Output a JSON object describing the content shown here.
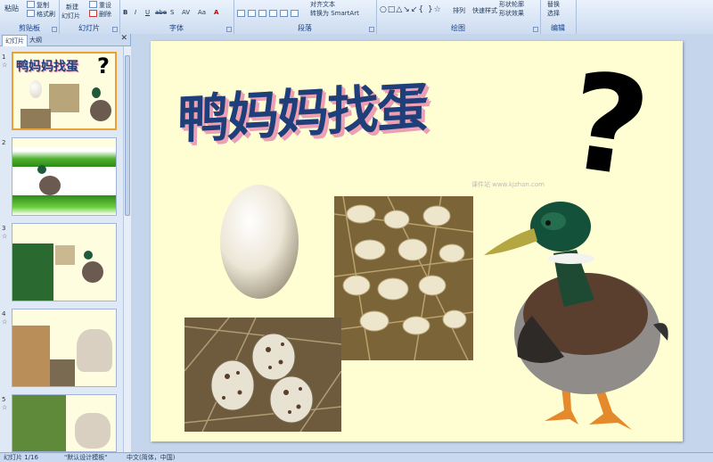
{
  "ribbon": {
    "clipboard": {
      "paste": "粘贴",
      "copy": "复制",
      "format_painter": "格式刷",
      "title": "剪贴板"
    },
    "slides": {
      "new_slide": "新建",
      "new_slide_2": "幻灯片",
      "reset": "重设",
      "delete": "删除",
      "title": "幻灯片"
    },
    "font": {
      "bold": "B",
      "italic": "I",
      "underline": "U",
      "strike": "abe",
      "shadow": "S",
      "spacing": "AV",
      "case": "Aa",
      "color": "A",
      "title": "字体"
    },
    "paragraph": {
      "text_direction": "对齐文本",
      "smartart": "转换为 SmartArt",
      "title": "段落"
    },
    "drawing": {
      "arrange": "排列",
      "quick_styles": "快速样式",
      "shape_fill": "形状轮廓",
      "shape_effects": "形状效果",
      "title": "绘图"
    },
    "editing": {
      "replace": "替换",
      "select": "选择",
      "title": "编辑"
    }
  },
  "panel": {
    "tab_slides": "幻灯片",
    "tab_outline": "大纲",
    "close": "✕",
    "thumbs": [
      {
        "num": "1"
      },
      {
        "num": "2"
      },
      {
        "num": "3"
      },
      {
        "num": "4"
      },
      {
        "num": "5"
      }
    ]
  },
  "slide": {
    "title": "鸭妈妈找蛋",
    "question_mark": "?",
    "watermark": "课件站 www.kjzhan.com"
  },
  "status": {
    "slide_pos": "幻灯片 1/16",
    "theme": "\"默认设计模板\"",
    "language": "中文(简体，中国)"
  },
  "colors": {
    "ribbon": "#dbe7f6",
    "slide_bg": "#fffed3",
    "title": "#1f3f7a",
    "title_shadow": "#f29fb0"
  }
}
